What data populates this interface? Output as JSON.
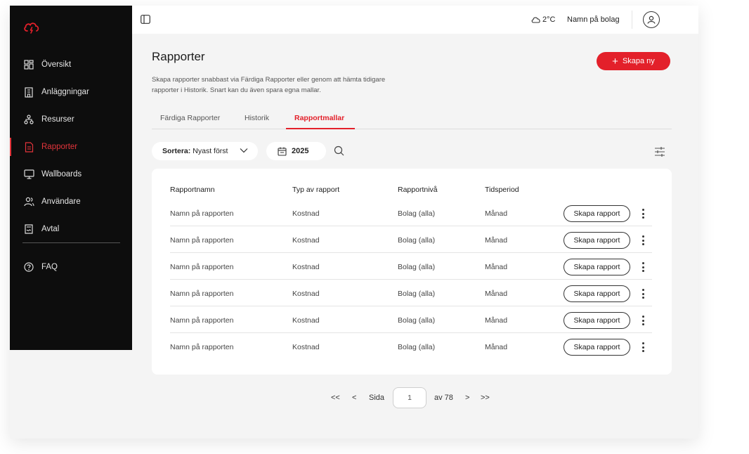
{
  "sidebar": {
    "items": [
      {
        "label": "Översikt",
        "icon": "grid-icon"
      },
      {
        "label": "Anläggningar",
        "icon": "building-icon"
      },
      {
        "label": "Resurser",
        "icon": "hierarchy-icon"
      },
      {
        "label": "Rapporter",
        "icon": "report-icon",
        "active": true
      },
      {
        "label": "Wallboards",
        "icon": "monitor-icon"
      },
      {
        "label": "Användare",
        "icon": "users-icon"
      },
      {
        "label": "Avtal",
        "icon": "contract-icon"
      }
    ],
    "faq": {
      "label": "FAQ",
      "icon": "question-icon"
    }
  },
  "topbar": {
    "temperature": "2°C",
    "company": "Namn på bolag"
  },
  "page": {
    "title": "Rapporter",
    "description": "Skapa rapporter snabbast via Färdiga Rapporter eller genom att hämta tidigare rapporter i Historik. Snart kan du även spara egna mallar.",
    "create_label": "Skapa ny"
  },
  "tabs": [
    {
      "label": "Färdiga Rapporter"
    },
    {
      "label": "Historik"
    },
    {
      "label": "Rapportmallar",
      "active": true
    }
  ],
  "filters": {
    "sort_prefix": "Sortera:",
    "sort_value": "Nyast först",
    "year": "2025"
  },
  "table": {
    "headers": [
      "Rapportnamn",
      "Typ av rapport",
      "Rapportnivå",
      "Tidsperiod"
    ],
    "action_label": "Skapa rapport",
    "rows": [
      [
        "Namn på rapporten",
        "Kostnad",
        "Bolag (alla)",
        "Månad"
      ],
      [
        "Namn på rapporten",
        "Kostnad",
        "Bolag (alla)",
        "Månad"
      ],
      [
        "Namn på rapporten",
        "Kostnad",
        "Bolag (alla)",
        "Månad"
      ],
      [
        "Namn på rapporten",
        "Kostnad",
        "Bolag (alla)",
        "Månad"
      ],
      [
        "Namn på rapporten",
        "Kostnad",
        "Bolag (alla)",
        "Månad"
      ],
      [
        "Namn på rapporten",
        "Kostnad",
        "Bolag (alla)",
        "Månad"
      ]
    ]
  },
  "pagination": {
    "first": "<<",
    "prev": "<",
    "page_label": "Sida",
    "current": "1",
    "total_label": "av 78",
    "next": ">",
    "last": ">>"
  },
  "colors": {
    "accent": "#e3202a",
    "sidebar_bg": "#0d0d0d",
    "content_bg": "#f4f4f4"
  }
}
